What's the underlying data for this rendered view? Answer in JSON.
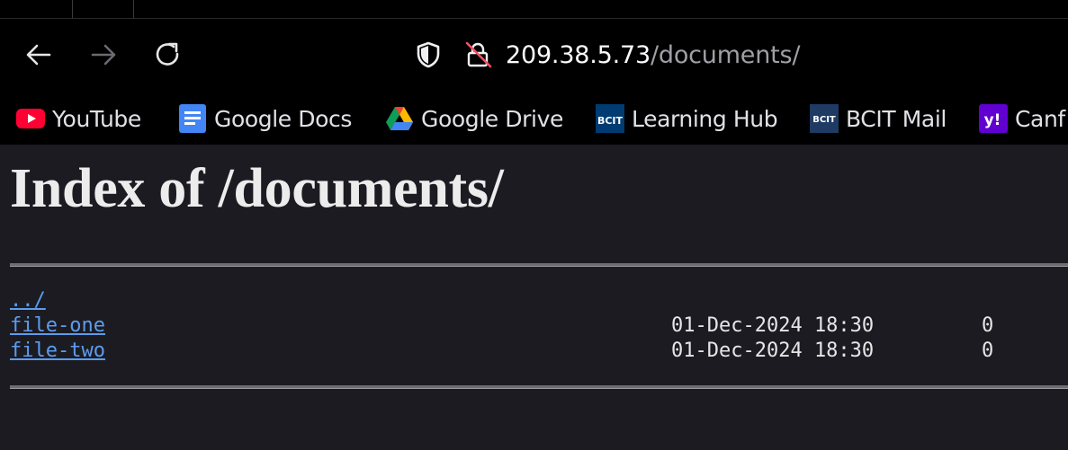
{
  "browser": {
    "url": {
      "host": "209.38.5.73",
      "path": "/documents/"
    },
    "bookmarks": [
      {
        "label": "YouTube",
        "icon": "youtube-icon"
      },
      {
        "label": "Google Docs",
        "icon": "google-docs-icon"
      },
      {
        "label": "Google Drive",
        "icon": "google-drive-icon"
      },
      {
        "label": "Learning Hub",
        "icon": "bcit-learning-hub-icon"
      },
      {
        "label": "BCIT Mail",
        "icon": "bcit-mail-icon"
      },
      {
        "label": "Canf",
        "icon": "yahoo-icon"
      }
    ],
    "bcit_badge": "BCIT",
    "yahoo_badge": "y!"
  },
  "page": {
    "title": "Index of /documents/",
    "entries": [
      {
        "name": "../",
        "date": "",
        "size": ""
      },
      {
        "name": "file-one",
        "date": "01-Dec-2024 18:30",
        "size": "0"
      },
      {
        "name": "file-two",
        "date": "01-Dec-2024 18:30",
        "size": "0"
      }
    ]
  },
  "colors": {
    "chrome_bg": "#000000",
    "page_bg": "#1c1b22",
    "link": "#5c9ded",
    "text": "#e6e6e6",
    "youtube_red": "#ff0033",
    "docs_blue": "#4285f4",
    "bcit_navy": "#003c71",
    "yahoo_purple": "#6001d2"
  }
}
